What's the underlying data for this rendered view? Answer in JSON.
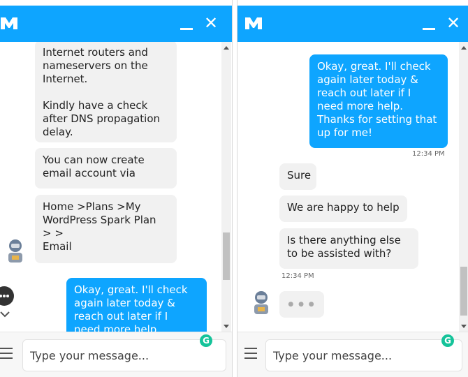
{
  "left": {
    "composer_placeholder": "Type your message...",
    "agent_bubbles": [
      "Internet routers and\nnameservers on the\nInternet.\n\nKindly have a  check\nafter DNS propagation\ndelay.",
      "You can now create\nemail account via",
      "Home >Plans >My\nWordPress Spark Plan\n>                    >\nEmail"
    ],
    "user_bubble": "Okay, great. I'll check\nagain later today &\nreach out later if I\nneed more help."
  },
  "right": {
    "composer_placeholder": "Type your message...",
    "user_bubble": "Okay, great. I'll check\nagain later today &\nreach out later if I\nneed more help.\nThanks for setting that\nup for me!",
    "user_time": "12:34 PM",
    "agent_bubbles": [
      "Sure",
      "We are happy to help",
      "Is there anything else\nto be assisted with?"
    ],
    "agent_time": "12:34 PM",
    "typing_dots": "● ● ●"
  },
  "common": {
    "close_glyph": "✕",
    "grammarly_glyph": "G"
  },
  "colors": {
    "header": "#0ea5ff",
    "user_bubble": "#0ea5ff",
    "agent_bubble": "#f1f1f1",
    "grammarly": "#15c39a"
  },
  "icons": [
    "brand-logo-icon",
    "minimize-icon",
    "close-icon",
    "menu-icon",
    "grammarly-icon",
    "agent-avatar-icon",
    "more-options-icon",
    "chevron-down-icon"
  ]
}
